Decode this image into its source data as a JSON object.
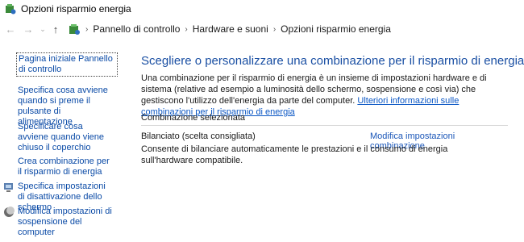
{
  "window": {
    "title": "Opzioni risparmio energia",
    "icon": "power-options-icon"
  },
  "nav": {
    "breadcrumbs": [
      "Pannello di controllo",
      "Hardware e suoni",
      "Opzioni risparmio energia"
    ]
  },
  "sidebar": {
    "items": [
      {
        "label": "Pagina iniziale Pannello di controllo"
      },
      {
        "label": "Specifica cosa avviene quando si preme il pulsante di alimentazione"
      },
      {
        "label": "Specificare cosa avviene quando viene chiuso il coperchio"
      },
      {
        "label": "Crea combinazione per il risparmio di energia"
      },
      {
        "label": "Specifica impostazioni di disattivazione dello schermo",
        "icon": "monitor-shield-icon"
      },
      {
        "label": "Modifica impostazioni di sospensione del computer",
        "icon": "moon-icon"
      }
    ]
  },
  "main": {
    "heading": "Scegliere o personalizzare una combinazione per il risparmio di energia",
    "description": "Una combinazione per il risparmio di energia è un insieme di impostazioni hardware e di sistema (relative ad esempio a luminosità dello schermo, sospensione e così via) che gestiscono l'utilizzo dell'energia da parte del computer.",
    "more_info_link": "Ulteriori informazioni sulle combinazioni per il risparmio di energia",
    "group_label": "Combinazione selezionata",
    "plan": {
      "name": "Bilanciato (scelta consigliata)",
      "change_link": "Modifica impostazioni combinazione",
      "description": "Consente di bilanciare automaticamente le prestazioni e il consumo di energia sull'hardware compatibile."
    }
  }
}
